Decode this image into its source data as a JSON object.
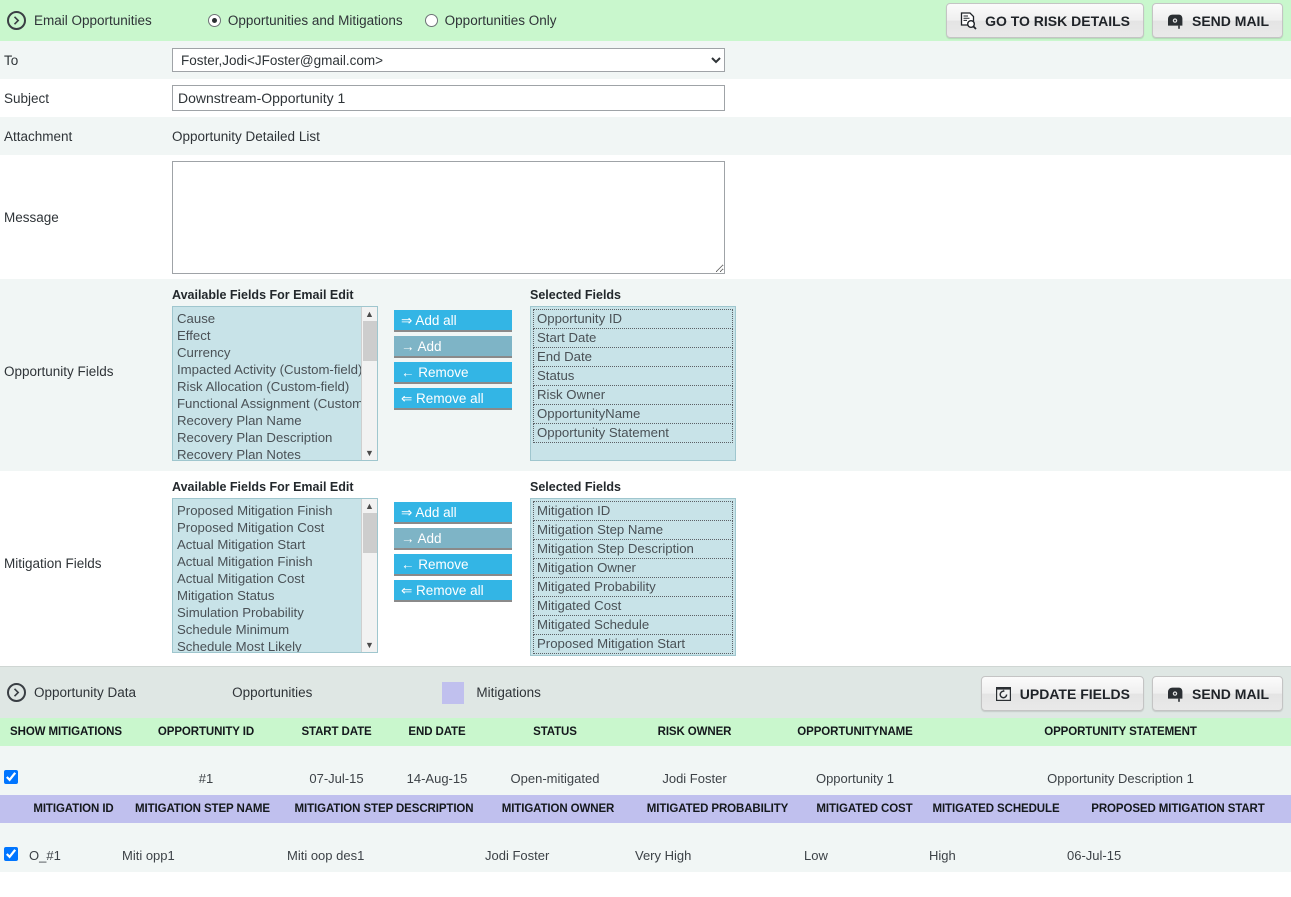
{
  "header": {
    "icon": "circle-arrow-right-icon",
    "title": "Email Opportunities",
    "radios": [
      {
        "label": "Opportunities and Mitigations",
        "checked": true
      },
      {
        "label": "Opportunities Only",
        "checked": false
      }
    ],
    "buttons": [
      {
        "label": "GO TO RISK DETAILS",
        "icon": "document-search-icon"
      },
      {
        "label": "SEND MAIL",
        "icon": "mailbox-icon"
      }
    ]
  },
  "form": {
    "to": {
      "label": "To",
      "value": "Foster,Jodi<JFoster@gmail.com>",
      "options": [
        "Foster,Jodi<JFoster@gmail.com>"
      ]
    },
    "subject": {
      "label": "Subject",
      "value": "Downstream-Opportunity 1",
      "placeholder": ""
    },
    "attachment": {
      "label": "Attachment",
      "value": "Opportunity Detailed List"
    },
    "message": {
      "label": "Message",
      "value": "",
      "placeholder": ""
    }
  },
  "opportunity_fields": {
    "label": "Opportunity Fields",
    "available_header": "Available Fields For Email Edit",
    "selected_header": "Selected Fields",
    "available": [
      "Cause",
      "Effect",
      "Currency",
      "Impacted Activity (Custom-field)",
      "Risk Allocation (Custom-field)",
      "Functional Assignment (Custom-f",
      "Recovery Plan Name",
      "Recovery Plan Description",
      "Recovery Plan Notes"
    ],
    "selected": [
      "Opportunity ID",
      "Start Date",
      "End Date",
      "Status",
      "Risk Owner",
      "OpportunityName",
      "Opportunity Statement"
    ],
    "buttons": [
      {
        "label": "⇒ Add all",
        "state": "active"
      },
      {
        "label": "→ Add",
        "state": "muted"
      },
      {
        "label": "← Remove",
        "state": "active"
      },
      {
        "label": "⇐ Remove all",
        "state": "active"
      }
    ]
  },
  "mitigation_fields": {
    "label": "Mitigation Fields",
    "available_header": "Available Fields For Email Edit",
    "selected_header": "Selected Fields",
    "available": [
      "Proposed Mitigation Finish",
      "Proposed Mitigation Cost",
      "Actual Mitigation Start",
      "Actual Mitigation Finish",
      "Actual Mitigation Cost",
      "Mitigation Status",
      "Simulation Probability",
      "Schedule Minimum",
      "Schedule Most Likely"
    ],
    "selected": [
      "Mitigation ID",
      "Mitigation Step Name",
      "Mitigation Step Description",
      "Mitigation Owner",
      "Mitigated Probability",
      "Mitigated Cost",
      "Mitigated Schedule",
      "Proposed Mitigation Start"
    ],
    "buttons": [
      {
        "label": "⇒ Add all",
        "state": "active"
      },
      {
        "label": "→ Add",
        "state": "muted"
      },
      {
        "label": "← Remove",
        "state": "active"
      },
      {
        "label": "⇐ Remove all",
        "state": "active"
      }
    ]
  },
  "data_section": {
    "icon": "circle-arrow-right-icon",
    "title": "Opportunity Data",
    "legend_opportunities": "Opportunities",
    "legend_mitigations": "Mitigations",
    "buttons": [
      {
        "label": "UPDATE FIELDS",
        "icon": "refresh-window-icon"
      },
      {
        "label": "SEND MAIL",
        "icon": "mailbox-icon"
      }
    ]
  },
  "opportunity_table": {
    "headers": [
      "SHOW MITIGATIONS",
      "OPPORTUNITY ID",
      "START DATE",
      "END DATE",
      "STATUS",
      "RISK OWNER",
      "OPPORTUNITYNAME",
      "OPPORTUNITY STATEMENT"
    ],
    "row": {
      "show_mitigations": true,
      "opportunity_id": "#1",
      "start_date": "07-Jul-15",
      "end_date": "14-Aug-15",
      "status": "Open-mitigated",
      "risk_owner": "Jodi Foster",
      "opportunity_name": "Opportunity 1",
      "opportunity_statement": "Opportunity Description 1"
    }
  },
  "mitigation_table": {
    "headers": [
      "",
      "MITIGATION ID",
      "MITIGATION STEP NAME",
      "MITIGATION STEP DESCRIPTION",
      "MITIGATION OWNER",
      "MITIGATED PROBABILITY",
      "MITIGATED COST",
      "MITIGATED SCHEDULE",
      "PROPOSED MITIGATION START"
    ],
    "row": {
      "checked": true,
      "mitigation_id": "O_#1",
      "mitigation_step_name": "Miti opp1",
      "mitigation_step_description": "Miti oop des1",
      "mitigation_owner": "Jodi Foster",
      "mitigated_probability": "Very High",
      "mitigated_cost": "Low",
      "mitigated_schedule": "High",
      "proposed_mitigation_start": "06-Jul-15"
    }
  },
  "colors": {
    "green_header": "#c9f7cd",
    "purple_header": "#c0c0ee",
    "teal_listbox": "#c8e3e8",
    "accent_button": "#33b5e5",
    "muted_button": "#7eb4c6",
    "row_bg": "#f1f6f5",
    "data_bar": "#dfe7e4"
  }
}
